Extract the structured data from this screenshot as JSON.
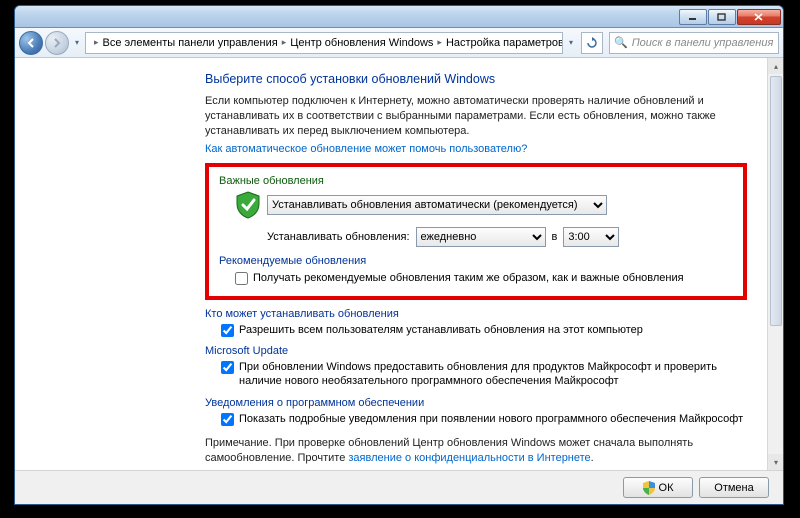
{
  "breadcrumb": {
    "item1": "Все элементы панели управления",
    "item2": "Центр обновления Windows",
    "item3": "Настройка параметров"
  },
  "search": {
    "placeholder": "Поиск в панели управления"
  },
  "page": {
    "title": "Выберите способ установки обновлений Windows",
    "intro": "Если компьютер подключен к Интернету, можно автоматически проверять наличие обновлений и устанавливать их в соответствии с выбранными параметрами. Если есть обновления, можно также устанавливать их перед выключением компьютера.",
    "help_link": "Как автоматическое обновление может помочь пользователю?"
  },
  "important": {
    "label": "Важные обновления",
    "mode_option": "Устанавливать обновления автоматически (рекомендуется)",
    "schedule_label": "Устанавливать обновления:",
    "freq_option": "ежедневно",
    "at": "в",
    "time_option": "3:00"
  },
  "recommended": {
    "label": "Рекомендуемые обновления",
    "checkbox": "Получать рекомендуемые обновления таким же образом, как и важные обновления"
  },
  "who": {
    "label": "Кто может устанавливать обновления",
    "checkbox": "Разрешить всем пользователям устанавливать обновления на этот компьютер"
  },
  "msupdate": {
    "label": "Microsoft Update",
    "checkbox": "При обновлении Windows предоставить обновления для продуктов Майкрософт и проверить наличие нового необязательного программного обеспечения Майкрософт"
  },
  "notify": {
    "label": "Уведомления о программном обеспечении",
    "checkbox": "Показать подробные уведомления при появлении нового программного обеспечения Майкрософт"
  },
  "note": {
    "prefix": "Примечание. При проверке обновлений Центр обновления Windows может сначала выполнять самообновление. Прочтите ",
    "link": "заявление о конфиденциальности в Интернете",
    "suffix": "."
  },
  "buttons": {
    "ok": "ОК",
    "cancel": "Отмена"
  }
}
